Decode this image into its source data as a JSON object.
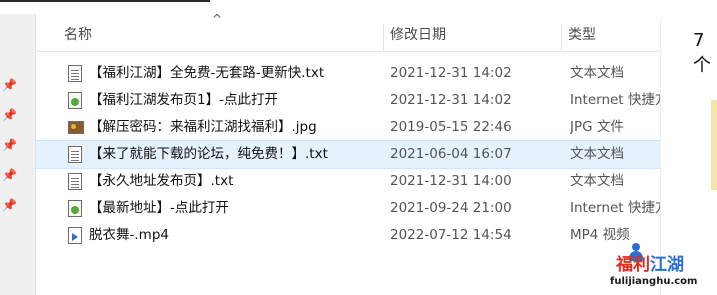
{
  "columns": {
    "name": "名称",
    "date": "修改日期",
    "type": "类型"
  },
  "files": [
    {
      "name": "【福利江湖】全免费-无套路-更新快.txt",
      "date": "2021-12-31 14:02",
      "type": "文本文档",
      "icon": "text-file-icon"
    },
    {
      "name": "【福利江湖发布页1】-点此打开",
      "date": "2021-12-31 14:02",
      "type": "Internet 快捷方式",
      "icon": "internet-shortcut-icon"
    },
    {
      "name": "【解压密码：来福利江湖找福利】.jpg",
      "date": "2019-05-15 22:46",
      "type": "JPG 文件",
      "icon": "image-file-icon"
    },
    {
      "name": "【来了就能下载的论坛，纯免费！】.txt",
      "date": "2021-06-04 16:07",
      "type": "文本文档",
      "icon": "text-file-icon"
    },
    {
      "name": "【永久地址发布页】.txt",
      "date": "2021-12-31 14:00",
      "type": "文本文档",
      "icon": "text-file-icon"
    },
    {
      "name": "【最新地址】-点此打开",
      "date": "2021-09-24 21:00",
      "type": "Internet 快捷方式",
      "icon": "internet-shortcut-icon"
    },
    {
      "name": "脱衣舞-.mp4",
      "date": "2022-07-12 14:54",
      "type": "MP4 视频",
      "icon": "video-file-icon"
    }
  ],
  "selected_index": 3,
  "right_pane_text": "7 个",
  "watermark": {
    "title_part1": "福利",
    "title_part2": "江湖",
    "subtitle": "fulijianghu.com"
  },
  "colors": {
    "selection": "#e5f1fb",
    "watermark_red": "#e02b20",
    "watermark_blue": "#2a6fd6"
  }
}
